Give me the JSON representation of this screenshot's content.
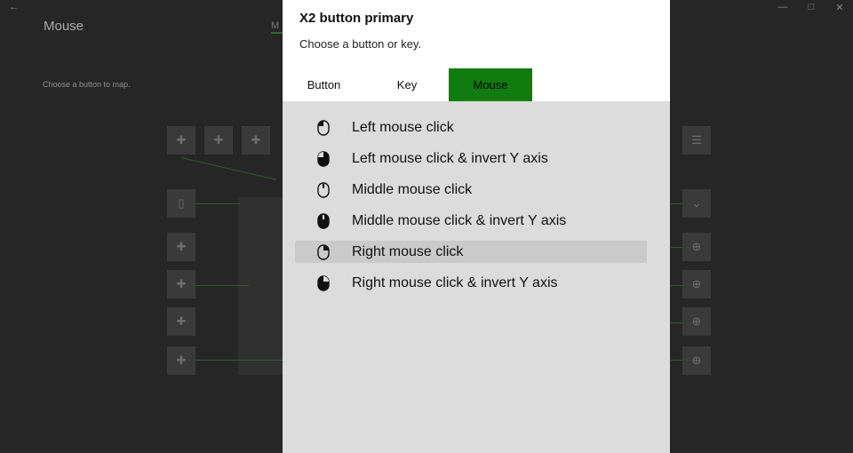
{
  "background": {
    "title": "Mouse",
    "tab_label": "M",
    "hint": "Choose a button to map."
  },
  "dialog": {
    "title": "X2 button primary",
    "subtitle": "Choose a button or key.",
    "tabs": [
      {
        "label": "Button",
        "selected": false
      },
      {
        "label": "Key",
        "selected": false
      },
      {
        "label": "Mouse",
        "selected": true
      }
    ],
    "accent_color": "#107c10",
    "items": [
      {
        "label": "Left mouse click",
        "icon": "mouse-left-outline-icon"
      },
      {
        "label": "Left mouse click & invert Y axis",
        "icon": "mouse-left-filled-icon"
      },
      {
        "label": "Middle mouse click",
        "icon": "mouse-middle-outline-icon"
      },
      {
        "label": "Middle mouse click & invert Y axis",
        "icon": "mouse-middle-filled-icon"
      },
      {
        "label": "Right mouse click",
        "icon": "mouse-right-outline-icon",
        "hovered": true
      },
      {
        "label": "Right mouse click & invert Y axis",
        "icon": "mouse-right-filled-icon"
      }
    ]
  }
}
